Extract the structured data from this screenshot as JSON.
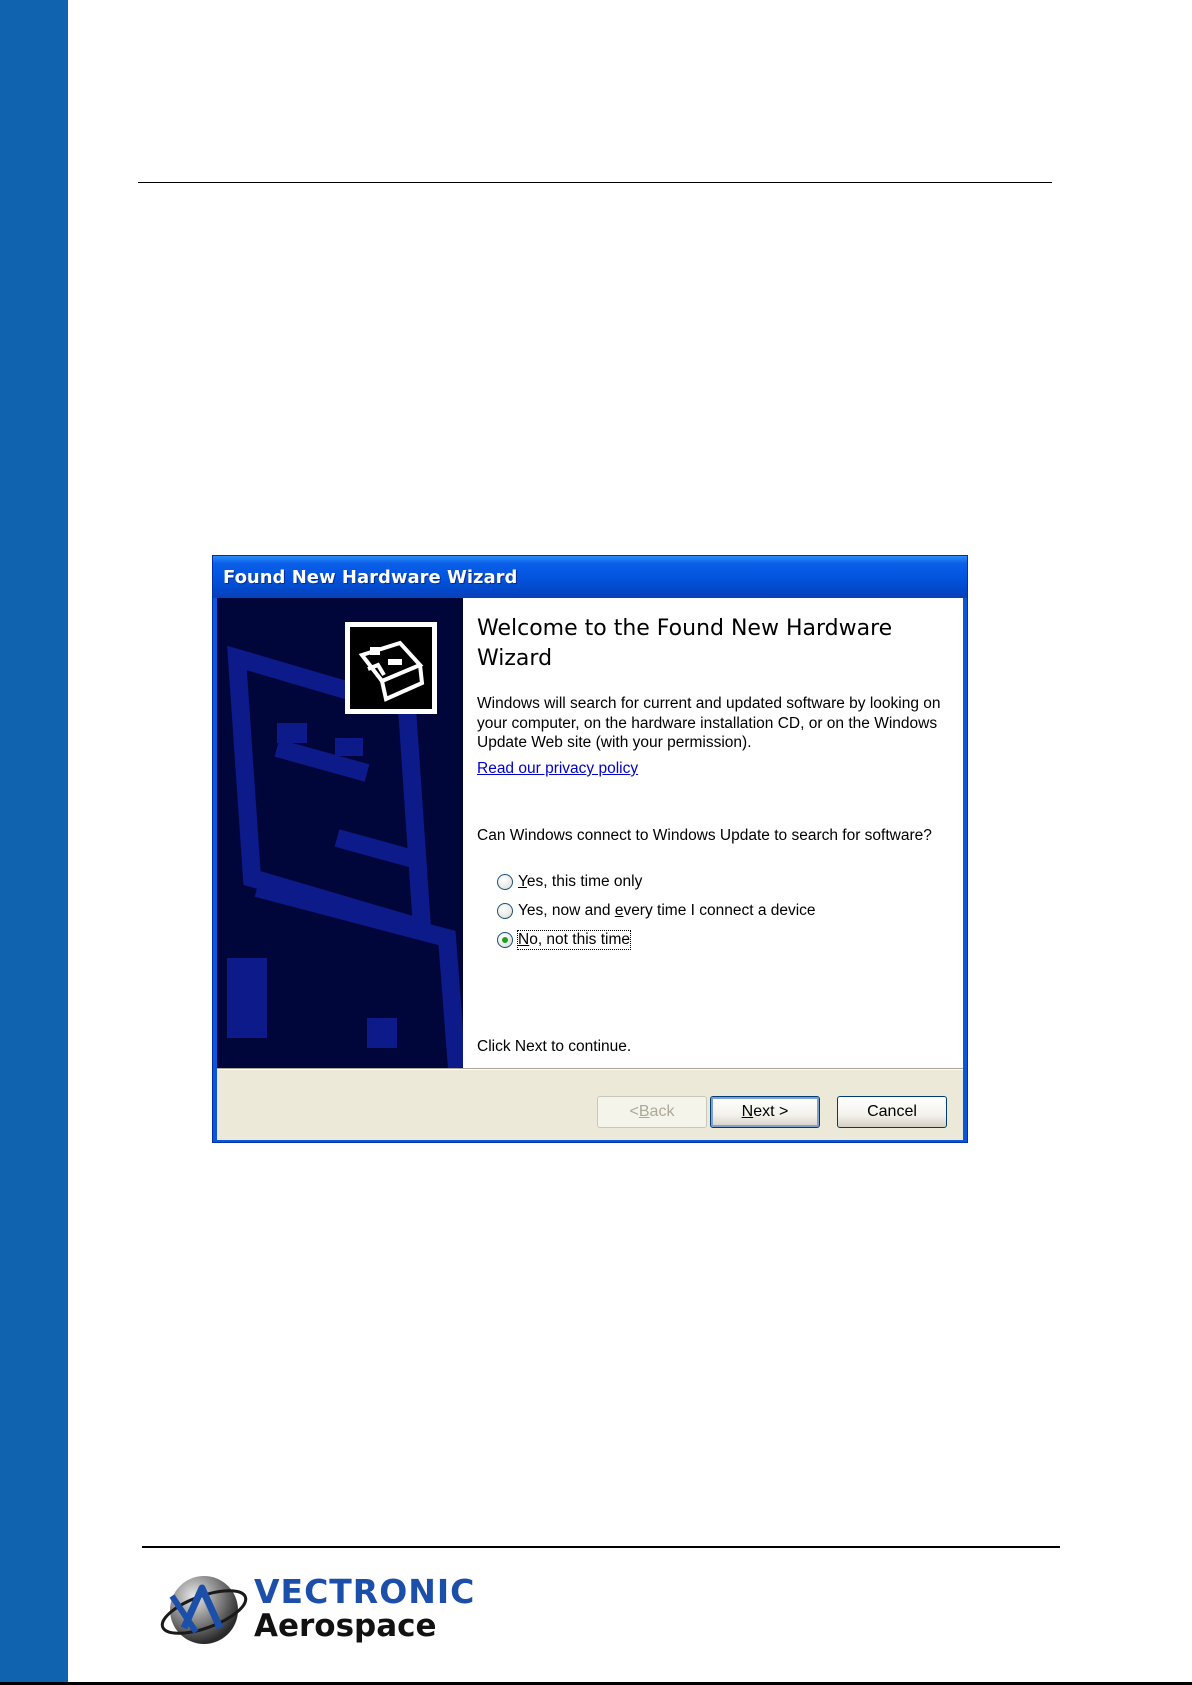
{
  "dialog": {
    "title": "Found New Hardware Wizard",
    "heading": "Welcome to the Found New Hardware Wizard",
    "description": "Windows will search for current and updated software by looking on your computer, on the hardware installation CD, or on the Windows Update Web site (with your permission).",
    "privacy_link": "Read our privacy policy",
    "question": "Can Windows connect to Windows Update to search for software?",
    "options": [
      {
        "pre": "",
        "key": "Y",
        "post": "es, this time only",
        "checked": false
      },
      {
        "pre": "Yes, now and ",
        "key": "e",
        "post": "very time I connect a device",
        "checked": false
      },
      {
        "pre": "",
        "key": "N",
        "post": "o, not this time",
        "checked": true
      }
    ],
    "continue_text": "Click Next to continue.",
    "buttons": {
      "back": {
        "pre": "< ",
        "key": "B",
        "post": "ack"
      },
      "next": {
        "pre": "",
        "key": "N",
        "post": "ext >"
      },
      "cancel": "Cancel"
    }
  },
  "logo": {
    "line1": "VECTRONIC",
    "line2": "Aerospace"
  },
  "colors": {
    "band": "#1063ae",
    "titlebar": "#0355df",
    "sidebar": "#00063a",
    "logo_blue": "#1c4faa"
  }
}
